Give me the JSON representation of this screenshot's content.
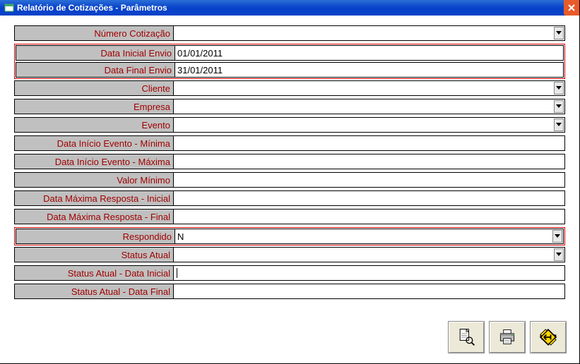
{
  "window": {
    "title": "Relatório de Cotizações - Parâmetros"
  },
  "fields": {
    "numero_cotizacao": {
      "label": "Número Cotização",
      "value": "",
      "dropdown": true
    },
    "data_inicial_envio": {
      "label": "Data Inicial Envio",
      "value": "01/01/2011",
      "dropdown": false
    },
    "data_final_envio": {
      "label": "Data Final Envio",
      "value": "31/01/2011",
      "dropdown": false
    },
    "cliente": {
      "label": "Cliente",
      "value": "",
      "dropdown": true
    },
    "empresa": {
      "label": "Empresa",
      "value": "",
      "dropdown": true
    },
    "evento": {
      "label": "Evento",
      "value": "",
      "dropdown": true
    },
    "data_inicio_evento_min": {
      "label": "Data Início Evento - Mínima",
      "value": "",
      "dropdown": false
    },
    "data_inicio_evento_max": {
      "label": "Data Início Evento - Máxima",
      "value": "",
      "dropdown": false
    },
    "valor_minimo": {
      "label": "Valor Mínimo",
      "value": "",
      "dropdown": false
    },
    "data_max_resposta_inicial": {
      "label": "Data Máxima Resposta - Inicial",
      "value": "",
      "dropdown": false
    },
    "data_max_resposta_final": {
      "label": "Data Máxima Resposta - Final",
      "value": "",
      "dropdown": false
    },
    "respondido": {
      "label": "Respondido",
      "value": "N",
      "dropdown": true
    },
    "status_atual": {
      "label": "Status Atual",
      "value": "",
      "dropdown": true
    },
    "status_atual_data_inicial": {
      "label": "Status Atual - Data Inicial",
      "value": "",
      "dropdown": false,
      "focused": true
    },
    "status_atual_data_final": {
      "label": "Status Atual - Data Final",
      "value": "",
      "dropdown": false
    }
  },
  "buttons": {
    "preview": "preview-icon",
    "print": "print-icon",
    "exit": "exit-icon"
  }
}
